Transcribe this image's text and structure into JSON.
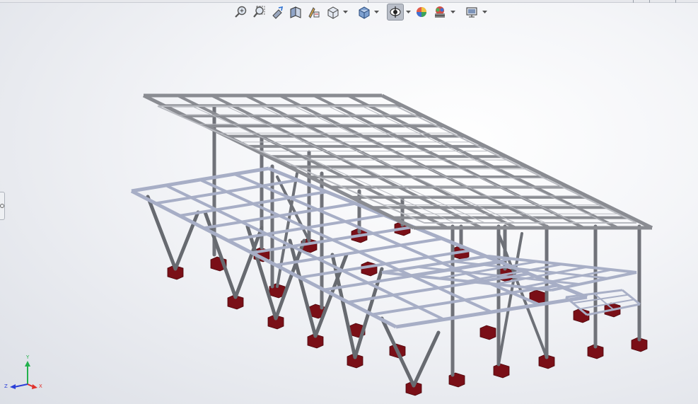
{
  "toolbar": {
    "buttons": [
      {
        "name": "zoom-to-fit-icon",
        "label": ""
      },
      {
        "name": "zoom-to-area-icon",
        "label": ""
      },
      {
        "name": "previous-view-icon",
        "label": ""
      },
      {
        "name": "section-view-icon",
        "label": ""
      },
      {
        "name": "dynamic-annotation-icon",
        "label": ""
      },
      {
        "name": "view-orientation-icon",
        "label": ""
      },
      {
        "name": "display-style-icon",
        "label": ""
      },
      {
        "name": "hide-show-items-icon",
        "label": ""
      },
      {
        "name": "edit-appearance-icon",
        "label": ""
      },
      {
        "name": "apply-scene-icon",
        "label": ""
      },
      {
        "name": "view-settings-icon",
        "label": ""
      }
    ]
  },
  "triad": {
    "y_label": "Y",
    "x_label": "X",
    "z_label": "Z",
    "colors": {
      "y": "#22b14c",
      "x": "#e0312b",
      "z": "#2b3fd8"
    }
  },
  "colors": {
    "steel_top": "#c9cbd0",
    "steel_side": "#6f7178",
    "steel_blue": "#a9b0c8",
    "footing": "#7a0f17"
  }
}
